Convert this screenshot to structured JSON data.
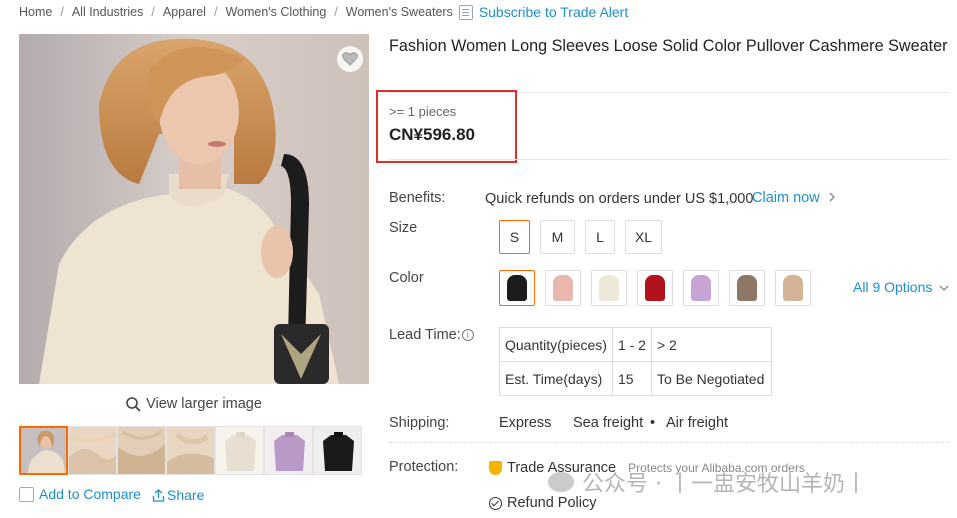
{
  "breadcrumb": {
    "items": [
      "Home",
      "All Industries",
      "Apparel",
      "Women's Clothing",
      "Women's Sweaters"
    ],
    "separator": "/",
    "subscribe_label": "Subscribe to Trade Alert"
  },
  "gallery": {
    "view_larger_label": "View larger image",
    "thumbnails": [
      {
        "name": "model-front",
        "colors": [
          "#d9c2ad",
          "#c99a66"
        ]
      },
      {
        "name": "fabric-closeup",
        "colors": [
          "#ead7c3",
          "#dcc3a8"
        ]
      },
      {
        "name": "knit-detail",
        "colors": [
          "#e3cfb9",
          "#cfb393"
        ]
      },
      {
        "name": "cuff-detail",
        "colors": [
          "#e8d6c1",
          "#d5bc9f"
        ]
      },
      {
        "name": "cream-sweater",
        "colors": [
          "#f7f3ec",
          "#e8dfd2"
        ]
      },
      {
        "name": "lilac-sweater",
        "colors": [
          "#f1edf1",
          "#b99ac7"
        ]
      },
      {
        "name": "black-sweater",
        "colors": [
          "#eeeeee",
          "#1a1a1a"
        ]
      }
    ],
    "add_to_compare_label": "Add to Compare",
    "share_label": "Share",
    "favorite_icon": "heart-icon"
  },
  "product": {
    "title": "Fashion Women Long Sleeves Loose Solid Color Pullover Cashmere Sweater",
    "moq_label": ">= 1 pieces",
    "price": "CN¥596.80",
    "highlight_color": "#d9302c"
  },
  "benefits": {
    "label": "Benefits:",
    "text": "Quick refunds on orders under US $1,000",
    "claim_label": "Claim now",
    "claim_icon": "chevron-right-icon"
  },
  "size": {
    "label": "Size",
    "options": [
      "S",
      "M",
      "L",
      "XL"
    ],
    "selected": "S"
  },
  "color": {
    "label": "Color",
    "swatches": [
      {
        "name": "black",
        "hex": "#1c1c1c"
      },
      {
        "name": "pink",
        "hex": "#e8b7ae"
      },
      {
        "name": "cream",
        "hex": "#efe7d8"
      },
      {
        "name": "red",
        "hex": "#b1121c"
      },
      {
        "name": "lilac",
        "hex": "#c6a4d3"
      },
      {
        "name": "taupe",
        "hex": "#8d7867"
      },
      {
        "name": "camel",
        "hex": "#d3b497"
      }
    ],
    "selected": "black",
    "all_options_label": "All 9 Options"
  },
  "lead_time": {
    "label": "Lead Time:",
    "rows": [
      [
        "Quantity(pieces)",
        "1 - 2",
        "> 2"
      ],
      [
        "Est. Time(days)",
        "15",
        "To Be Negotiated"
      ]
    ]
  },
  "shipping": {
    "label": "Shipping:",
    "methods": [
      "Express",
      "Sea freight",
      "Air freight"
    ]
  },
  "protection": {
    "label": "Protection:",
    "trade_assurance": "Trade Assurance",
    "protects_text": "Protects your Alibaba.com orders",
    "refund_policy": "Refund Policy"
  },
  "watermark": {
    "text": "公众号 · 丨一盅安牧山羊奶丨"
  },
  "colors": {
    "link": "#1d8fcf",
    "selected_border": "#ff6a00",
    "trade_assurance_icon": "#f5b400"
  }
}
